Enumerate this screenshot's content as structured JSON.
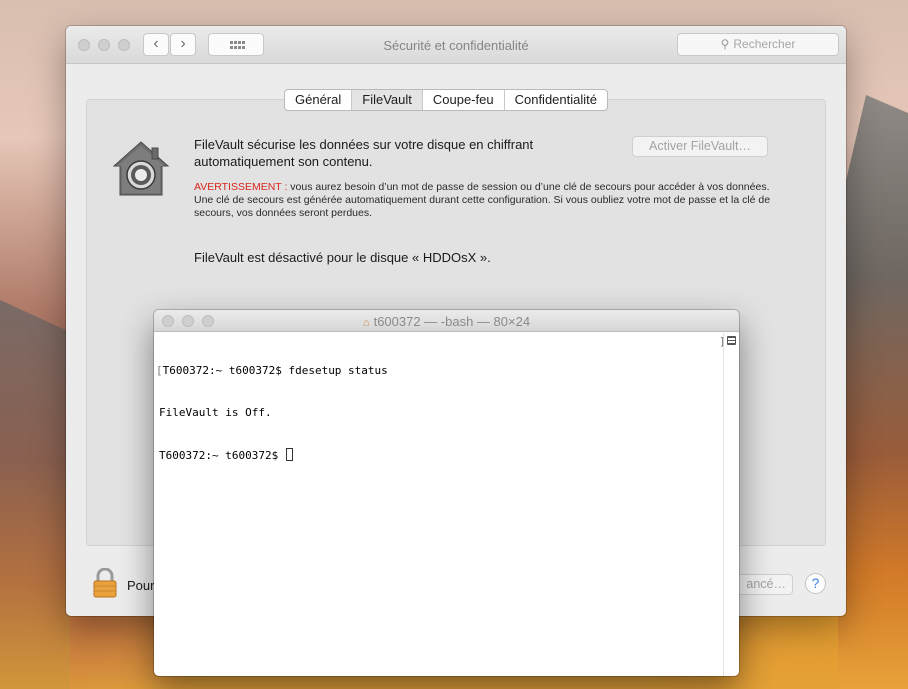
{
  "prefs": {
    "title": "Sécurité et confidentialité",
    "search_placeholder": "Rechercher",
    "tabs": [
      {
        "label": "Général",
        "active": false
      },
      {
        "label": "FileVault",
        "active": true
      },
      {
        "label": "Coupe-feu",
        "active": false
      },
      {
        "label": "Confidentialité",
        "active": false
      }
    ],
    "filevault": {
      "description": "FileVault sécurise les données sur votre disque en chiffrant automatiquement son contenu.",
      "warning_label": "AVERTISSEMENT :",
      "warning_text": " vous aurez besoin d’un mot de passe de session ou d’une clé de secours pour accéder à vos données. Une clé de secours est générée automatiquement durant cette configuration. Si vous oubliez votre mot de passe et la clé de secours, vos données seront perdues.",
      "status": "FileVault est désactivé pour le disque « HDDOsX ».",
      "enable_button": "Activer FileVault…"
    },
    "lock_text": "Pour",
    "advanced_button": "ancé…",
    "help_label": "?"
  },
  "terminal": {
    "title": "t600372 — -bash — 80×24",
    "lines": [
      "T600372:~ t600372$ fdesetup status",
      "FileVault is Off.",
      "T600372:~ t600372$ "
    ]
  },
  "colors": {
    "warning_red": "#d8261d",
    "help_blue": "#3a7ee6"
  }
}
